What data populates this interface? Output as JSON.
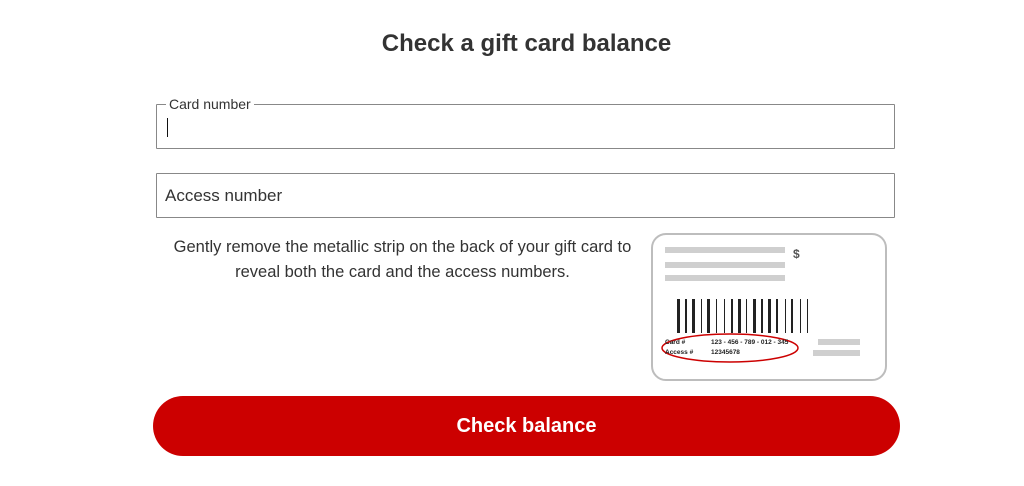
{
  "page": {
    "title": "Check a gift card balance"
  },
  "form": {
    "card_number": {
      "label": "Card number",
      "value": ""
    },
    "access_number": {
      "placeholder": "Access number",
      "value": ""
    },
    "hint": "Gently remove the metallic strip on the back of your gift card to reveal both the card and the access numbers.",
    "submit_label": "Check balance"
  },
  "card_illustration": {
    "currency_symbol": "$",
    "card_label": "Card #",
    "card_value": "123 - 456 - 789 - 012 - 345",
    "access_label": "Access #",
    "access_value": "12345678"
  },
  "colors": {
    "primary_button": "#cc0000",
    "highlight_ellipse": "#cc0000",
    "field_border": "#888888",
    "text": "#333333"
  }
}
